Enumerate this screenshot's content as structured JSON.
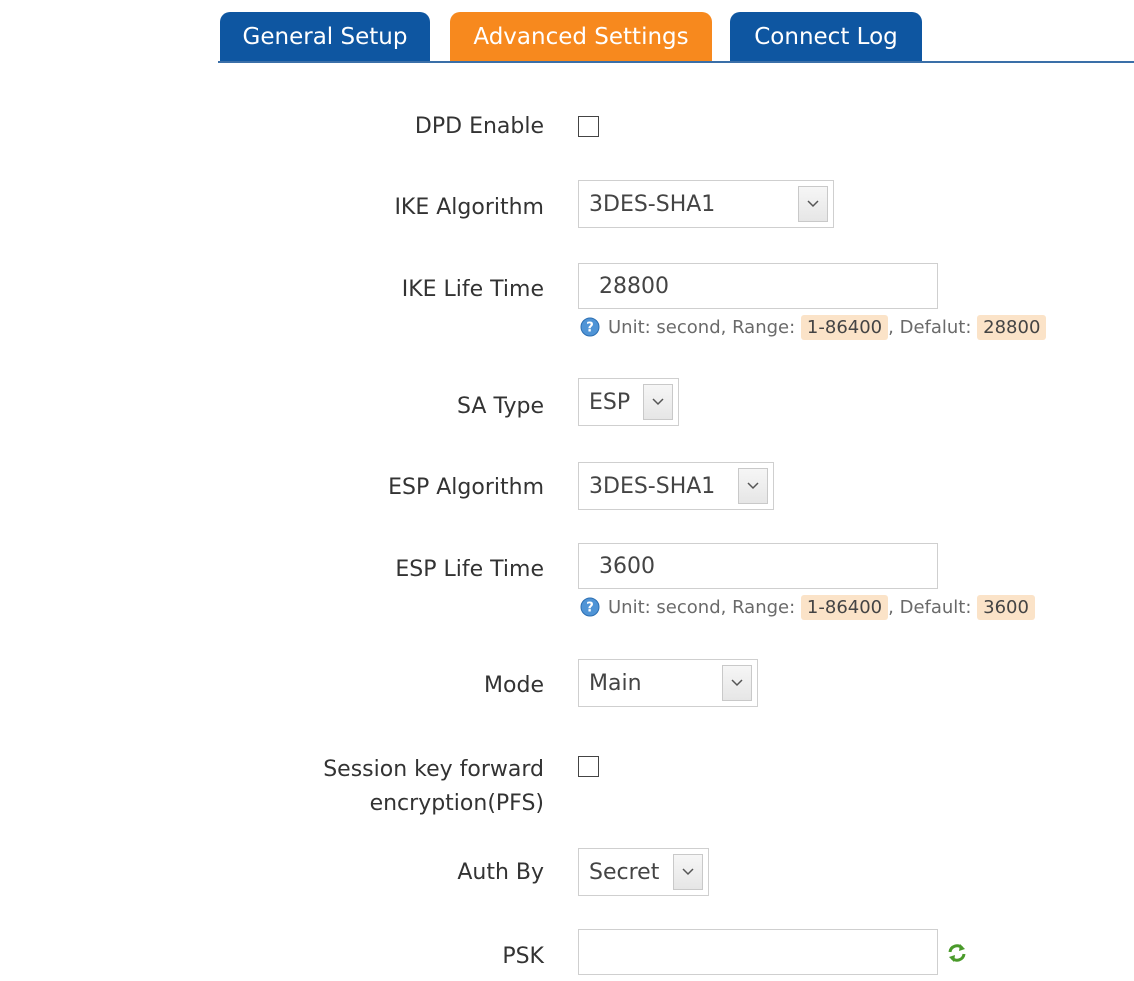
{
  "tabs": {
    "general": "General Setup",
    "advanced": "Advanced Settings",
    "log": "Connect Log"
  },
  "colors": {
    "tab_inactive": "#0e56a1",
    "tab_active": "#f7891e",
    "highlight": "#fbe3c8"
  },
  "form": {
    "dpd": {
      "label": "DPD Enable",
      "checked": false
    },
    "ike_algorithm": {
      "label": "IKE Algorithm",
      "value": "3DES-SHA1"
    },
    "ike_life_time": {
      "label": "IKE Life Time",
      "value": "28800",
      "hint": {
        "unit": "Unit: second, Range:",
        "range": "1-86400",
        "sep": ", Defalut:",
        "default": "28800"
      }
    },
    "sa_type": {
      "label": "SA Type",
      "value": "ESP"
    },
    "esp_algorithm": {
      "label": "ESP Algorithm",
      "value": "3DES-SHA1"
    },
    "esp_life_time": {
      "label": "ESP Life Time",
      "value": "3600",
      "hint": {
        "unit": "Unit: second, Range:",
        "range": "1-86400",
        "sep": ", Default:",
        "default": "3600"
      }
    },
    "mode": {
      "label": "Mode",
      "value": "Main"
    },
    "pfs": {
      "label_line1": "Session key forward",
      "label_line2": "encryption(PFS)",
      "checked": false
    },
    "auth_by": {
      "label": "Auth By",
      "value": "Secret"
    },
    "psk": {
      "label": "PSK",
      "value": ""
    }
  },
  "icons": {
    "hint": "question-circle-icon",
    "dropdown": "chevron-down-icon",
    "psk_action": "refresh-icon"
  }
}
